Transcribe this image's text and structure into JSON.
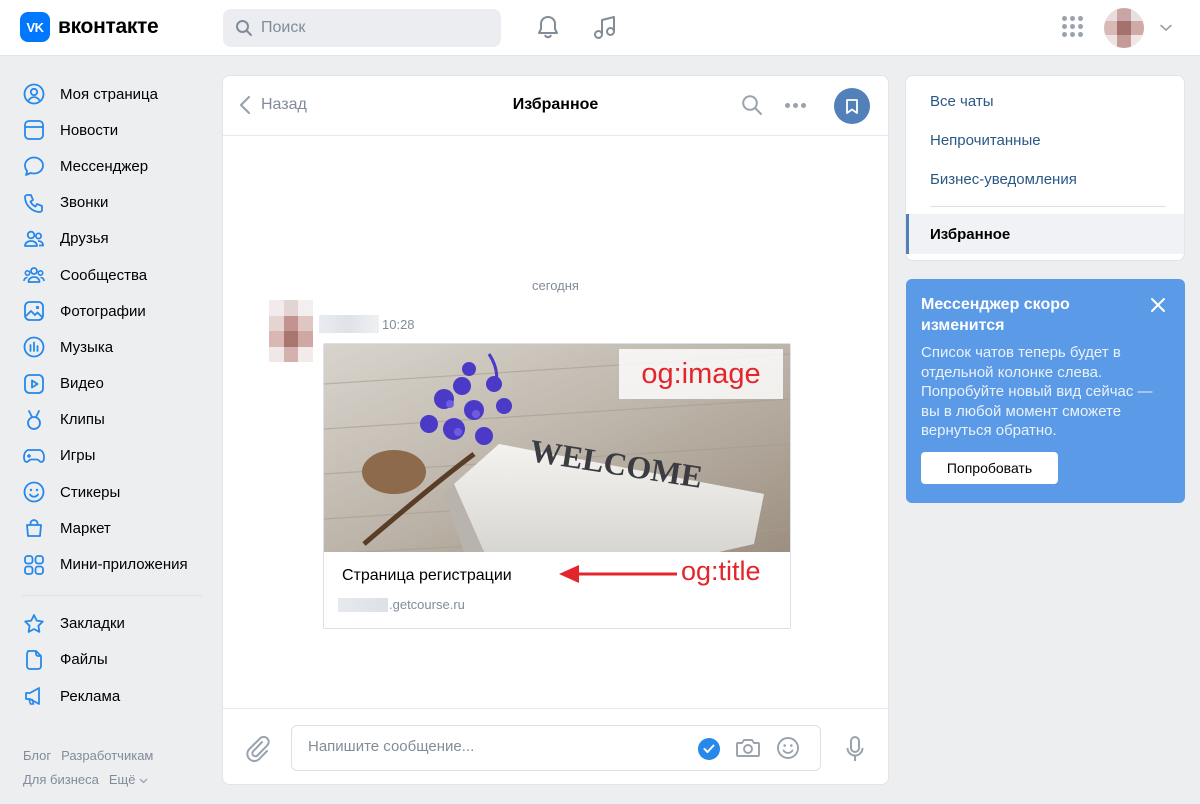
{
  "header": {
    "logo_mark": "VK",
    "logo_text": "вконтакте",
    "search_placeholder": "Поиск",
    "icons": [
      "bell-icon",
      "music-note-icon",
      "apps-grid-icon",
      "chevron-down-icon"
    ]
  },
  "sidebar": {
    "items": [
      {
        "label": "Моя страница",
        "icon": "user-circle-icon"
      },
      {
        "label": "Новости",
        "icon": "news-icon"
      },
      {
        "label": "Мессенджер",
        "icon": "chat-bubble-icon"
      },
      {
        "label": "Звонки",
        "icon": "phone-icon"
      },
      {
        "label": "Друзья",
        "icon": "friends-icon"
      },
      {
        "label": "Сообщества",
        "icon": "communities-icon"
      },
      {
        "label": "Фотографии",
        "icon": "photo-icon"
      },
      {
        "label": "Музыка",
        "icon": "music-bars-icon"
      },
      {
        "label": "Видео",
        "icon": "video-icon"
      },
      {
        "label": "Клипы",
        "icon": "clips-icon"
      },
      {
        "label": "Игры",
        "icon": "gamepad-icon"
      },
      {
        "label": "Стикеры",
        "icon": "smile-icon"
      },
      {
        "label": "Маркет",
        "icon": "market-bag-icon"
      },
      {
        "label": "Мини-приложения",
        "icon": "mini-apps-icon"
      }
    ],
    "items2": [
      {
        "label": "Закладки",
        "icon": "star-icon"
      },
      {
        "label": "Файлы",
        "icon": "file-icon"
      },
      {
        "label": "Реклама",
        "icon": "megaphone-icon"
      }
    ],
    "footer": {
      "blog": "Блог",
      "developers": "Разработчикам",
      "business": "Для бизнеса",
      "more": "Ещё"
    }
  },
  "chat": {
    "back_label": "Назад",
    "title": "Избранное",
    "date_divider": "сегодня",
    "message": {
      "time": "10:28",
      "card_title": "Страница регистрации",
      "card_domain": ".getcourse.ru",
      "image_text": "WELCOME"
    },
    "annotations": {
      "og_image": "og:image",
      "og_title": "og:title"
    },
    "composer_placeholder": "Напишите сообщение..."
  },
  "right_menu": {
    "items": [
      "Все чаты",
      "Непрочитанные",
      "Бизнес-уведомления"
    ],
    "active": "Избранное"
  },
  "promo": {
    "title": "Мессенджер скоро изменится",
    "text": "Список чатов теперь будет в отдельной колонке слева. Попробуйте новый вид сейчас — вы в любой момент сможете вернуться обратно.",
    "button": "Попробовать"
  },
  "colors": {
    "brand": "#0077ff",
    "link": "#2a5885",
    "secondary": "#818c99",
    "promo_bg": "#5b9ae6",
    "annotation": "#e3262c"
  }
}
